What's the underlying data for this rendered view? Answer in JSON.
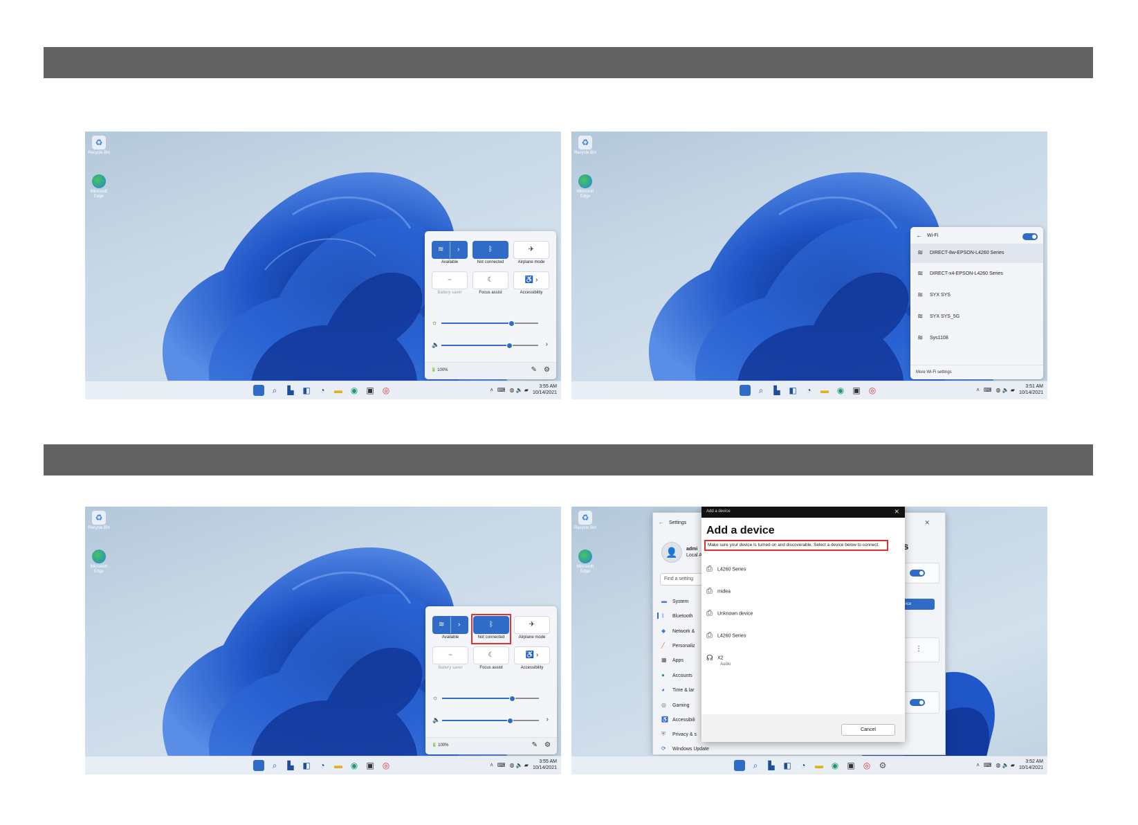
{
  "desktop": {
    "recycle_bin": "Recycle Bin",
    "edge": "Microsoft Edge"
  },
  "quick_settings": {
    "tiles": [
      {
        "label": "Available",
        "icon": "wifi-icon",
        "state": "on"
      },
      {
        "label": "Not connected",
        "icon": "bluetooth-icon",
        "state": "on"
      },
      {
        "label": "Airplane mode",
        "icon": "airplane-icon",
        "state": "off"
      },
      {
        "label": "Battery saver",
        "icon": "battery-saver-icon",
        "state": "disabled"
      },
      {
        "label": "Focus assist",
        "icon": "moon-icon",
        "state": "off"
      },
      {
        "label": "Accessibility",
        "icon": "accessibility-icon",
        "state": "off"
      }
    ],
    "brightness_level": 0.72,
    "volume_level": 0.7,
    "battery": "100%"
  },
  "wifi_panel": {
    "title": "Wi-Fi",
    "networks": [
      "DIRECT-8w-EPSON-L4260 Series",
      "DIRECT-x4-EPSON-L4260 Series",
      "SYX SYS",
      "SYX SYS_5G",
      "Sys1108"
    ],
    "footer": "More Wi-Fi settings"
  },
  "taskbar": {
    "time_1": "3:55 AM",
    "date_1": "10/14/2021",
    "time_2": "3:51 AM",
    "date_2": "10/14/2021",
    "time_3": "3:55 AM",
    "date_3": "10/14/2021",
    "time_4": "3:52 AM",
    "date_4": "10/14/2021"
  },
  "settings": {
    "window_title": "Settings",
    "user_name": "admi",
    "user_sub": "Local A",
    "search_placeholder": "Find a setting",
    "nav": [
      "System",
      "Bluetooth",
      "Network &",
      "Personaliz",
      "Apps",
      "Accounts",
      "Time & lar",
      "Gaming",
      "Accessibili",
      "Privacy & s",
      "Windows Update"
    ],
    "heading_fragment": "ces",
    "on_label_1": "On",
    "button_fragment": "d device",
    "on_label_2": "On"
  },
  "add_device": {
    "window_title": "Add a device",
    "heading": "Add a device",
    "message": "Make sure your device is turned on and discoverable. Select a device below to connect.",
    "devices": [
      {
        "name": "L4260 Series",
        "sub": ""
      },
      {
        "name": "midea",
        "sub": ""
      },
      {
        "name": "Unknown device",
        "sub": ""
      },
      {
        "name": "L4260 Series",
        "sub": ""
      },
      {
        "name": "X2",
        "sub": "Audio"
      }
    ],
    "cancel": "Cancel"
  },
  "colors": {
    "section_bar": "#626262",
    "accent": "#2f6bc7",
    "highlight": "#e03030"
  }
}
